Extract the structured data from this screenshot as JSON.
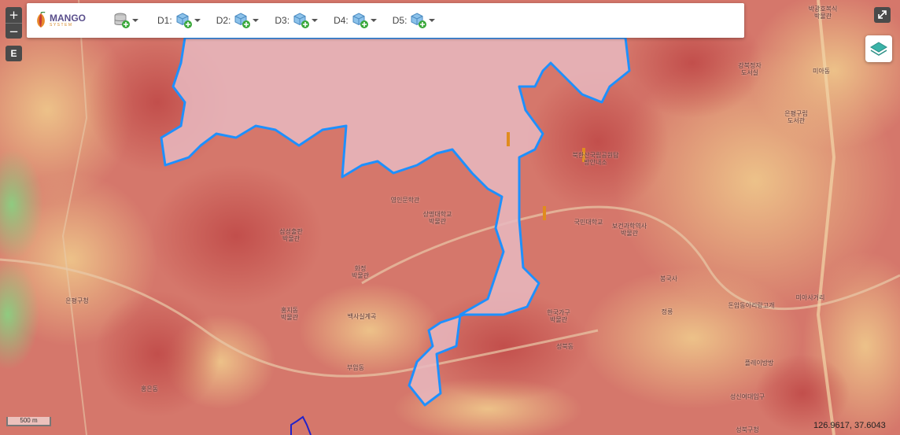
{
  "toolbar": {
    "logo": {
      "title": "MANGO",
      "subtitle": "SYSTEM"
    },
    "layer_menu": {
      "icon": "database-add-icon"
    },
    "datasets": [
      {
        "label": "D1:",
        "icon": "cube-add-icon"
      },
      {
        "label": "D2:",
        "icon": "cube-add-icon"
      },
      {
        "label": "D3:",
        "icon": "cube-add-icon"
      },
      {
        "label": "D4:",
        "icon": "cube-add-icon"
      },
      {
        "label": "D5:",
        "icon": "cube-add-icon"
      }
    ]
  },
  "controls": {
    "zoom_in": "+",
    "zoom_out": "−",
    "edit": "E",
    "fullscreen_icon": "expand-icon",
    "layers_icon": "layers-icon"
  },
  "scale_bar": "500 m",
  "cursor_coords": "126.9617, 37.6043",
  "colors": {
    "heat_high": "#c9564f",
    "heat_mid": "#e08a6a",
    "heat_low": "#e9b77c",
    "heat_green": "#9fcf86",
    "polygon_fill": "#e7b9c0",
    "polygon_stroke": "#1e90ff",
    "second_polygon_stroke": "#2323c8"
  },
  "places": [
    {
      "name": "박광호복식\n박물관"
    },
    {
      "name": "강북정자\n도서실"
    },
    {
      "name": "미아동"
    },
    {
      "name": "은평구립\n도서관"
    },
    {
      "name": "북한산국립공원탐방안내소"
    },
    {
      "name": "영인문학관"
    },
    {
      "name": "상명대학교\n박물관"
    },
    {
      "name": "국민대학교"
    },
    {
      "name": "보건과학역사\n박물관"
    },
    {
      "name": "삼성출판\n박물관"
    },
    {
      "name": "화정\n박물관"
    },
    {
      "name": "은평구청"
    },
    {
      "name": "홍지동\n박물관"
    },
    {
      "name": "백사실계곡"
    },
    {
      "name": "한국가구\n박물관"
    },
    {
      "name": "봉국사"
    },
    {
      "name": "돈암동아리랑고개"
    },
    {
      "name": "플레이방방"
    },
    {
      "name": "성북동"
    },
    {
      "name": "부암동"
    },
    {
      "name": "홍은동"
    },
    {
      "name": "성신여대입구"
    },
    {
      "name": "성북구청"
    },
    {
      "name": "미아사거리"
    },
    {
      "name": "정릉"
    }
  ]
}
